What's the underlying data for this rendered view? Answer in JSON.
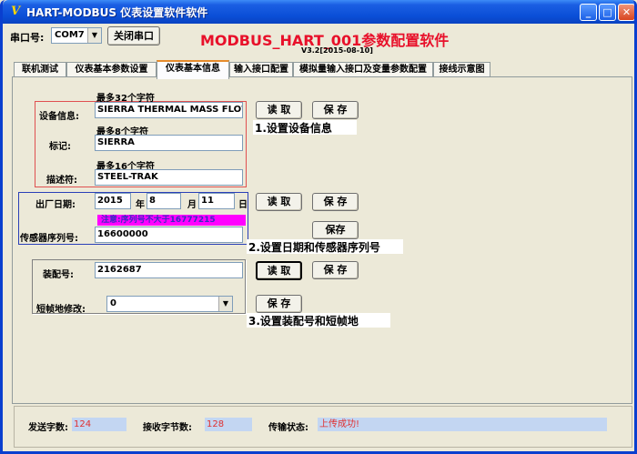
{
  "window": {
    "title": "HART-MODBUS 仪表设置软件软件",
    "min_icon": "minimize-icon",
    "max_icon": "maximize-icon",
    "close_icon": "close-icon"
  },
  "header": {
    "port_label": "串口号:",
    "port_value": "COM7",
    "close_port_button": "关闭串口",
    "app_title": "MODBUS_HART_001参数配置软件",
    "version": "V3.2[2015-08-10]"
  },
  "tabs": [
    {
      "label": "联机测试"
    },
    {
      "label": "仪表基本参数设置"
    },
    {
      "label": "仪表基本信息"
    },
    {
      "label": "输入接口配置"
    },
    {
      "label": "模拟量输入接口及变量参数配置"
    },
    {
      "label": "接线示意图"
    }
  ],
  "device_info": {
    "max32": "最多32个字符",
    "device_info_label": "设备信息:",
    "device_info_value": "SIERRA THERMAL MASS FLOW MI",
    "max8": "最多8个字符",
    "tag_label": "标记:",
    "tag_value": "SIERRA",
    "max16": "最多16个字符",
    "descriptor_label": "描述符:",
    "descriptor_value": "STEEL-TRAK",
    "read_button": "读 取",
    "save_button": "保 存",
    "note": "1.设置设备信息"
  },
  "date_serial": {
    "date_label": "出厂日期:",
    "year": "2015",
    "year_unit": "年",
    "month": "8",
    "month_unit": "月",
    "day": "11",
    "day_unit": "日",
    "read_button": "读 取",
    "save_button": "保 存",
    "warning": "注意:序列号不大于16777215",
    "serial_label": "传感器序列号:",
    "serial_value": "16600000",
    "save_serial_button": "保存",
    "note": "2.设置日期和传感器序列号"
  },
  "assembly": {
    "assembly_label": "装配号:",
    "assembly_value": "2162687",
    "read_button": "读 取",
    "save_button": "保 存",
    "short_addr_label": "短帧地修改:",
    "short_addr_value": "0",
    "save_short_button": "保 存",
    "note": "3.设置装配号和短帧地"
  },
  "status": {
    "sent_label": "发送字数:",
    "sent_value": "124",
    "recv_label": "接收字节数:",
    "recv_value": "128",
    "state_label": "传输状态:",
    "state_value": "上传成功!"
  },
  "colors": {
    "title_bar": "#0a4ed6",
    "app_title": "#e8102a",
    "warning_bg": "#ff00ff",
    "status_value": "#e03030"
  }
}
